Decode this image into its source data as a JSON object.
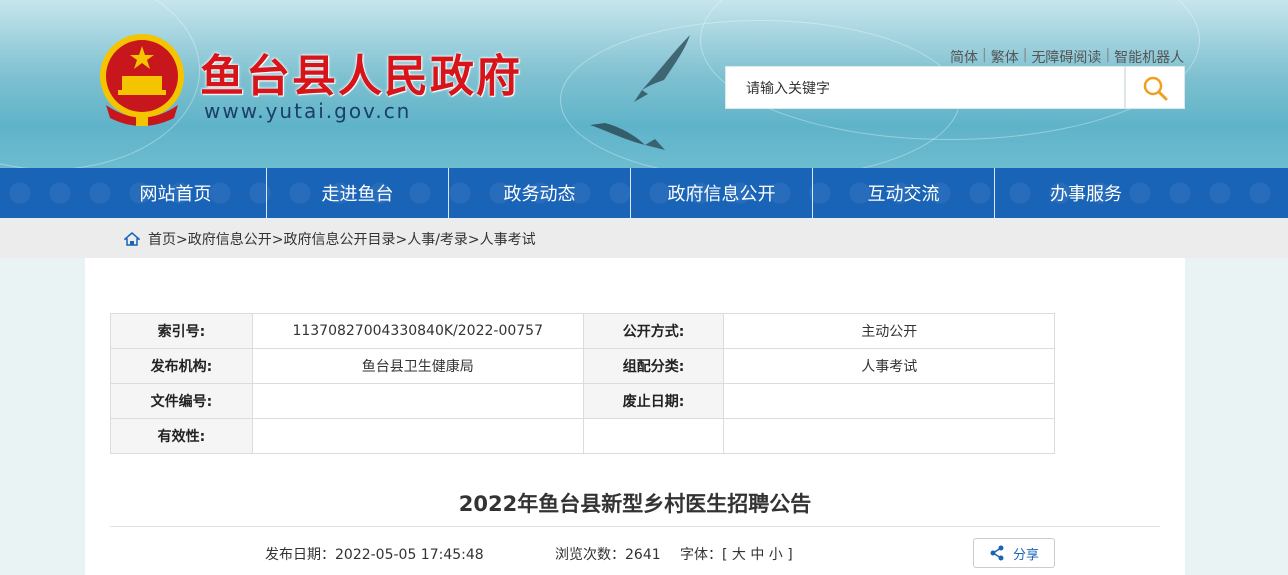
{
  "header": {
    "site_title": "鱼台县人民政府",
    "site_url": "www.yutai.gov.cn",
    "top_links": [
      "简体",
      "繁体",
      "无障碍阅读",
      "智能机器人"
    ],
    "search_placeholder": "请输入关键字"
  },
  "nav": {
    "items": [
      "网站首页",
      "走进鱼台",
      "政务动态",
      "政府信息公开",
      "互动交流",
      "办事服务"
    ]
  },
  "breadcrumb": "首页>政府信息公开>政府信息公开目录>人事/考录>人事考试",
  "meta": {
    "index_label": "索引号:",
    "index_value": "11370827004330840K/2022-00757",
    "open_label": "公开方式:",
    "open_value": "主动公开",
    "org_label": "发布机构:",
    "org_value": "鱼台县卫生健康局",
    "category_label": "组配分类:",
    "category_value": "人事考试",
    "docno_label": "文件编号:",
    "docno_value": "",
    "expire_label": "废止日期:",
    "expire_value": "",
    "valid_label": "有效性:",
    "valid_value": ""
  },
  "article": {
    "title": "2022年鱼台县新型乡村医生招聘公告",
    "publish_date": "发布日期：2022-05-05 17:45:48",
    "views": "浏览次数：2641",
    "font_size": "字体：[ 大 中 小 ]",
    "share_label": "分享"
  },
  "colors": {
    "nav_blue": "#1a64b8",
    "title_red": "#d7141a",
    "emblem_red": "#c8161d",
    "emblem_gold": "#f5c400"
  }
}
